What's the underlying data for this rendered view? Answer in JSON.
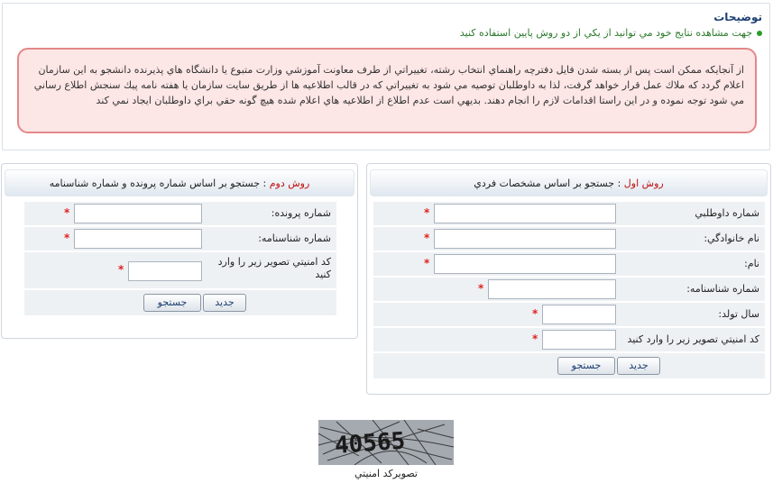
{
  "description": {
    "title": "توضيحات",
    "bullet": "جهت مشاهده نتايج خود مي توانيد از يكي از دو روش پايين استفاده كنيد",
    "warning": "از آنجايكه ممكن است پس از بسته شدن فايل دفترچه راهنماي انتخاب رشته، تغييراتي از طرف معاونت آموزشي وزارت متبوع يا دانشگاه هاي پذيرنده دانشجو به اين سازمان اعلام گردد كه ملاك عمل قرار خواهد گرفت، لذا به داوطلبان توصيه مي شود به تغييراتي كه در قالب اطلاعيه ها از طريق سايت سازمان يا هفته نامه پيك سنجش اطلاع رساني مي شود توجه نموده و در اين راستا اقدامات لازم را انجام دهند. بديهي است عدم اطلاع از اطلاعيه هاي اعلام شده هيچ گونه حقي براي داوطلبان ايجاد نمي كند"
  },
  "method1": {
    "prefix": "روش اول",
    "title": " : جستجو بر اساس مشخصات فردي",
    "fields": {
      "applicant_number": "شماره داوطلبي",
      "last_name": "نام خانوادگي:",
      "first_name": "نام:",
      "id_number": "شماره شناسنامه:",
      "birth_year": "سال تولد:",
      "captcha": "كد امنيتي تصوير زير را وارد كنيد"
    },
    "search_button": "جستجو",
    "new_button": "جديد"
  },
  "method2": {
    "prefix": "روش دوم",
    "title": " : جستجو بر اساس شماره پرونده و شماره شناسنامه",
    "fields": {
      "file_number": "شماره پرونده:",
      "id_number": "شماره شناسنامه:",
      "captcha": "كد امنيتي تصوير زير را وارد كنيد"
    },
    "search_button": "جستجو",
    "new_button": "جديد"
  },
  "required_mark": "*",
  "captcha": {
    "code": "40565",
    "label": "تصويركد امنيتي"
  }
}
